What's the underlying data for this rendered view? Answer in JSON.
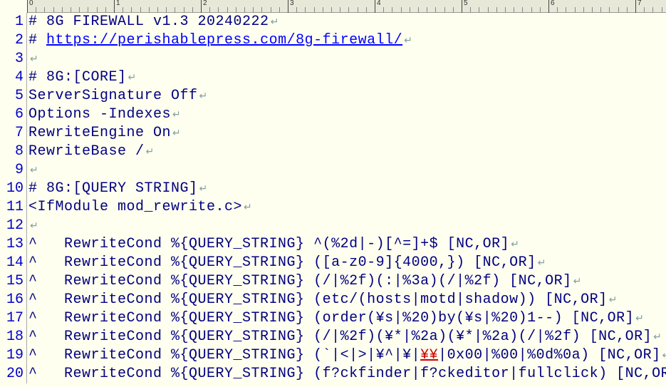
{
  "ruler": {
    "majors": [
      0,
      1,
      2,
      3,
      4,
      5,
      6,
      7
    ]
  },
  "lines": [
    {
      "n": 1,
      "segs": [
        {
          "t": "# 8G FIREWALL v1.3 20240222"
        }
      ],
      "eol": true
    },
    {
      "n": 2,
      "segs": [
        {
          "t": "# "
        },
        {
          "t": "https://perishablepress.com/8g-firewall/",
          "link": true
        }
      ],
      "eol": true
    },
    {
      "n": 3,
      "segs": [],
      "eol": true
    },
    {
      "n": 4,
      "segs": [
        {
          "t": "# 8G:[CORE]"
        }
      ],
      "eol": true
    },
    {
      "n": 5,
      "segs": [
        {
          "t": "ServerSignature Off"
        }
      ],
      "eol": true
    },
    {
      "n": 6,
      "segs": [
        {
          "t": "Options -Indexes"
        }
      ],
      "eol": true
    },
    {
      "n": 7,
      "segs": [
        {
          "t": "RewriteEngine On"
        }
      ],
      "eol": true
    },
    {
      "n": 8,
      "segs": [
        {
          "t": "RewriteBase /"
        }
      ],
      "eol": true
    },
    {
      "n": 9,
      "segs": [],
      "eol": true
    },
    {
      "n": 10,
      "segs": [
        {
          "t": "# 8G:[QUERY STRING]"
        }
      ],
      "eol": true
    },
    {
      "n": 11,
      "segs": [
        {
          "t": "<IfModule mod_rewrite.c>"
        }
      ],
      "eol": true
    },
    {
      "n": 12,
      "segs": [],
      "eol": true
    },
    {
      "n": 13,
      "segs": [
        {
          "t": "^   RewriteCond %{QUERY_STRING} ^(%2d|-)[^=]+$ [NC,OR]"
        }
      ],
      "eol": true
    },
    {
      "n": 14,
      "segs": [
        {
          "t": "^   RewriteCond %{QUERY_STRING} ([a-z0-9]{4000,}) [NC,OR]"
        }
      ],
      "eol": true
    },
    {
      "n": 15,
      "segs": [
        {
          "t": "^   RewriteCond %{QUERY_STRING} (/|%2f)(:|%3a)(/|%2f) [NC,OR]"
        }
      ],
      "eol": true
    },
    {
      "n": 16,
      "segs": [
        {
          "t": "^   RewriteCond %{QUERY_STRING} (etc/(hosts|motd|shadow)) [NC,OR]"
        }
      ],
      "eol": true
    },
    {
      "n": 17,
      "segs": [
        {
          "t": "^   RewriteCond %{QUERY_STRING} (order(¥s|%20)by(¥s|%20)1--) [NC,OR]"
        }
      ],
      "eol": true
    },
    {
      "n": 18,
      "segs": [
        {
          "t": "^   RewriteCond %{QUERY_STRING} (/|%2f)(¥*|%2a)(¥*|%2a)(/|%2f) [NC,OR]"
        }
      ],
      "eol": true
    },
    {
      "n": 19,
      "segs": [
        {
          "t": "^   RewriteCond %{QUERY_STRING} (`|<|>|¥^|¥|"
        },
        {
          "t": "¥¥",
          "red": true
        },
        {
          "t": "|0x00|%00|%0d%0a) [NC,OR]"
        }
      ],
      "eol": true
    },
    {
      "n": 20,
      "segs": [
        {
          "t": "^   RewriteCond %{QUERY_STRING} (f?ckfinder|f?ckeditor|fullclick) [NC,OR]"
        }
      ],
      "eol": true
    }
  ]
}
